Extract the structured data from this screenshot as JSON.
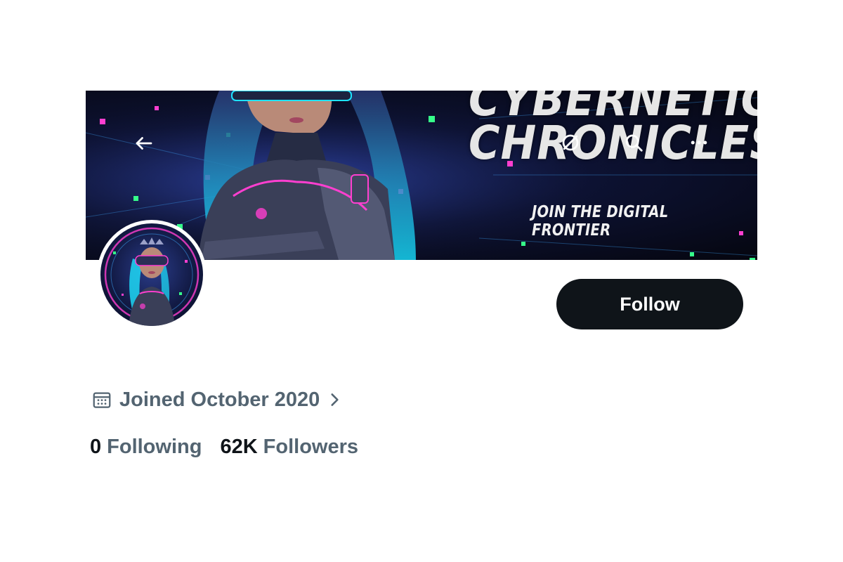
{
  "banner": {
    "title_line1": "CYBERNETIC",
    "title_line2": "CHRONICLES",
    "subtitle": "JOIN THE DIGITAL FRONTIER",
    "icons": [
      "back-arrow-icon",
      "grok-icon",
      "search-icon",
      "more-icon"
    ]
  },
  "profile": {
    "follow_label": "Follow",
    "joined_text": "Joined October 2020",
    "following_count": "0",
    "following_label": "Following",
    "followers_count": "62K",
    "followers_label": "Followers"
  },
  "colors": {
    "button_bg": "#0f1419",
    "secondary_text": "#536471",
    "primary_text": "#0f1419"
  }
}
